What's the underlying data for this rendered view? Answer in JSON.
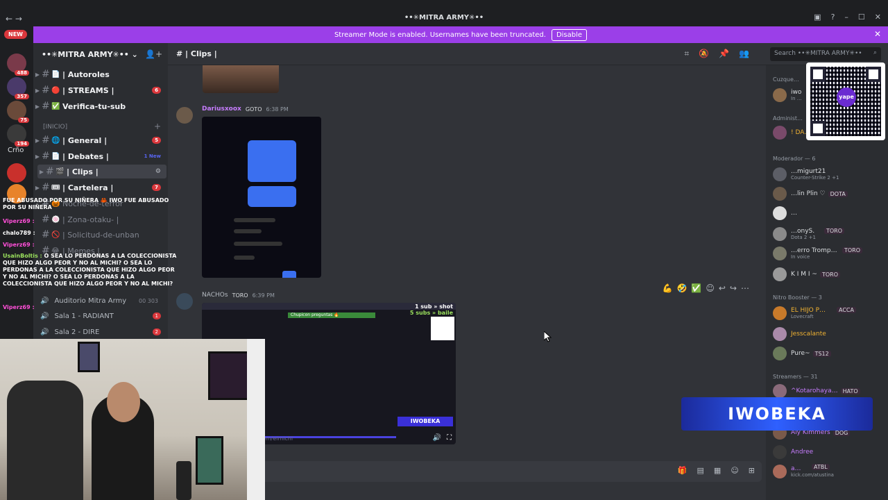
{
  "window": {
    "title": "••✳MITRA ARMY✳••",
    "back": "←",
    "forward": "→"
  },
  "banner": {
    "text": "Streamer Mode is enabled. Usernames have been truncated.",
    "button": "Disable",
    "close": "✕"
  },
  "servers": {
    "new_label": "NEW",
    "badges": [
      "488",
      "357",
      "75",
      "194"
    ],
    "text_item": "Crño"
  },
  "server": {
    "name": "••✳MITRA ARMY✳••",
    "name_chevron": "⌄"
  },
  "channels": [
    {
      "name": "| Autoroles",
      "emoji": "📄"
    },
    {
      "name": "| STREAMS |",
      "emoji": "🔴",
      "badge": "6"
    },
    {
      "name": "Verifica-tu-sub",
      "emoji": "✅"
    },
    {
      "name": "| General |",
      "emoji": "🌐",
      "badge": "5"
    },
    {
      "name": "| Debates |",
      "emoji": "📄",
      "new": "1 New"
    },
    {
      "name": "| Clips |",
      "emoji": "🎬"
    },
    {
      "name": "| Cartelera |",
      "emoji": "🎟",
      "badge": "7"
    },
    {
      "name": "Noche-de-terror",
      "emoji": "🎃"
    },
    {
      "name": "| Zona-otaku- |",
      "emoji": "🍥"
    },
    {
      "name": "| Solicitud-de-unban",
      "emoji": "🚫"
    },
    {
      "name": "| Memes |",
      "emoji": "😂"
    }
  ],
  "category": {
    "label": "[INICIO]",
    "add": "+"
  },
  "voice": [
    {
      "name": "Auditorio Mitra Army",
      "count": "00 303"
    },
    {
      "name": "Sala 1 - RADIANT",
      "badge": "1"
    },
    {
      "name": "Sala 2 - DIRE",
      "badge": "2"
    }
  ],
  "topbar": {
    "channel": "# | Clips |",
    "search_placeholder": "Search ••✳MITRA ARMY✳••"
  },
  "messages": [
    {
      "author": "Dariusxoox",
      "tag": "GOTO",
      "time": "6:38 PM"
    },
    {
      "author": "NACHOs",
      "tag": "TORO",
      "time": "6:39 PM"
    }
  ],
  "clip": {
    "sub_line1": "1 sub » shot",
    "sub_line2": "5 subs » baile",
    "chup": "Chupicon preguntas 🔥",
    "overlay": "IWOBEKA",
    "url": "kick.com/elmichi"
  },
  "reactions": [
    "💪",
    "🤣",
    "✅",
    "☺",
    "↩",
    "↪",
    "⋯"
  ],
  "members": {
    "categories": [
      "Cuzque…",
      "Administ…",
      "Moderador — 6",
      "Nitro Booster — 3",
      "Streamers — 31"
    ],
    "list": [
      {
        "name": "iwo",
        "status": "In …"
      },
      {
        "name": "! DA…",
        "status": ""
      },
      {
        "name": "…migurt21",
        "status": "Counter-Strike 2 +1"
      },
      {
        "name": "…lin Plin ♡",
        "tag": "DOTA"
      },
      {
        "name": "…",
        "status": ""
      },
      {
        "name": "…onyS.",
        "tag": "TORO",
        "status": "Dota 2 +1"
      },
      {
        "name": "…erro Tromp…",
        "tag": "TORO",
        "status": "In voice"
      },
      {
        "name": "K I M I ~",
        "tag": "TORO"
      },
      {
        "name": "EL HIJO P…",
        "tag": "ACCA",
        "status": "Lovecraft"
      },
      {
        "name": "Jesscalante",
        "status": ""
      },
      {
        "name": "Pure~",
        "tag": "TS12"
      },
      {
        "name": "^Kotarohaya…",
        "tag": "HATO"
      },
      {
        "name": "Aly Kimmers",
        "tag": "DOG"
      },
      {
        "name": "Andree",
        "status": ""
      },
      {
        "name": "a…",
        "tag": "ATBL",
        "status": "kick.com/atustina"
      }
    ]
  },
  "overlay_chat": [
    {
      "text": "FUE ABUSADO POR SU NIÑERA 🦀 IWO FUE ABUSADO POR SU NIÑERA"
    },
    {
      "user": "Viperz69 :",
      "text": ""
    },
    {
      "user": "chalo789 :",
      "text": ""
    },
    {
      "user": "Viperz69 :",
      "text": ""
    },
    {
      "user": "UsainBoltis :",
      "text": "O SEA LO PERDONAS A LA COLECCIONISTA QUE HIZO ALGO PEOR Y NO AL MICHI? O SEA LO PERDONAS A LA COLECCIONISTA QUE HIZO ALGO PEOR Y NO AL MICHI? O SEA LO PERDONAS A LA COLECCIONISTA QUE HIZO ALGO PEOR Y NO AL MICHI?"
    },
    {
      "user": "Viperz69 :",
      "text": ""
    }
  ],
  "streamer_tag": "IWOBEKA",
  "qr_logo": "yape",
  "colors": {
    "accent": "#9b3fe8",
    "bg": "#313338",
    "sidebar": "#2b2d31",
    "badge": "#da373c"
  }
}
